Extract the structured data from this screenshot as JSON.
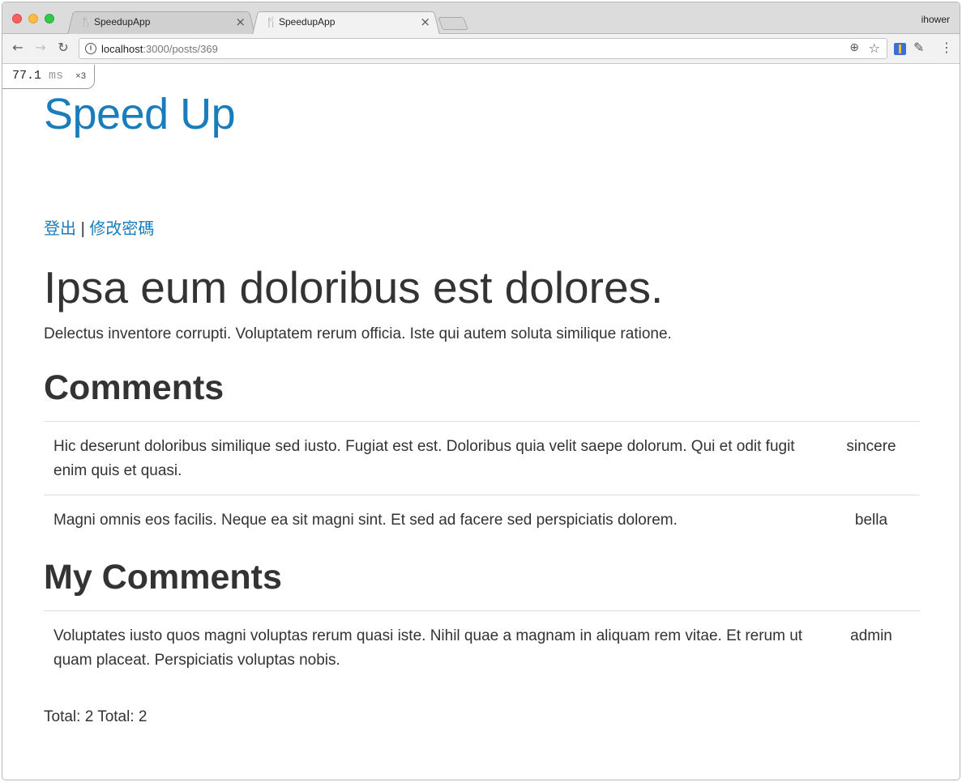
{
  "browser": {
    "tabs": [
      {
        "title": "SpeedupApp",
        "active": false
      },
      {
        "title": "SpeedupApp",
        "active": true
      }
    ],
    "profile_name": "ihower",
    "url_host": "localhost",
    "url_path": ":3000/posts/369"
  },
  "profiler": {
    "time": "77.1",
    "unit": "ms",
    "count": "×3"
  },
  "site": {
    "brand": "Speed Up",
    "logout_label": "登出",
    "separator": "|",
    "change_password_label": "修改密碼"
  },
  "post": {
    "title": "Ipsa eum doloribus est dolores.",
    "body": "Delectus inventore corrupti. Voluptatem rerum officia. Iste qui autem soluta similique ratione."
  },
  "comments_heading": "Comments",
  "comments": [
    {
      "text": "Hic deserunt doloribus similique sed iusto. Fugiat est est. Doloribus quia velit saepe dolorum. Qui et odit fugit enim quis et quasi.",
      "author": "sincere"
    },
    {
      "text": "Magni omnis eos facilis. Neque ea sit magni sint. Et sed ad facere sed perspiciatis dolorem.",
      "author": "bella"
    }
  ],
  "my_comments_heading": "My Comments",
  "my_comments": [
    {
      "text": "Voluptates iusto quos magni voluptas rerum quasi iste. Nihil quae a magnam in aliquam rem vitae. Et rerum ut quam placeat. Perspiciatis voluptas nobis.",
      "author": "admin"
    }
  ],
  "totals": "Total: 2 Total: 2",
  "icons": {
    "favicon": "fork-knife-icon",
    "back": "arrow-left-icon",
    "forward": "arrow-right-icon",
    "reload": "reload-icon",
    "info": "info-icon",
    "zoom": "zoom-icon",
    "bookmark": "star-icon",
    "menu": "kebab-menu-icon"
  },
  "colors": {
    "link": "#1a7dbb",
    "text": "#333333"
  }
}
